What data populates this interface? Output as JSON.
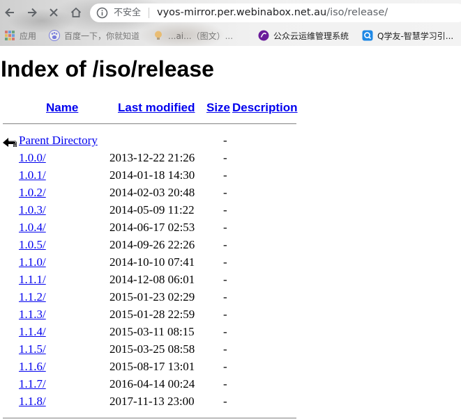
{
  "browser": {
    "security_label": "不安全",
    "url_host": "vyos-mirror.per.webinabox.net.au",
    "url_path": "/iso/release/",
    "bookmarks": [
      {
        "label": "应用",
        "icon": "apps-grid-icon"
      },
      {
        "label": "百度一下，你就知道",
        "icon": "baidu-paw-icon"
      },
      {
        "label": "...ai...（图文）...",
        "icon": "bulb-icon"
      },
      {
        "label": "公众云运维管理系统",
        "icon": "purple-orb-icon"
      },
      {
        "label": "Q学友-智慧学习引...",
        "icon": "q-logo-icon"
      }
    ]
  },
  "page": {
    "title": "Index of /iso/release",
    "headers": {
      "name": "Name",
      "last_modified": "Last modified",
      "size": "Size",
      "description": "Description"
    },
    "parent": {
      "name": "Parent Directory",
      "size": "-"
    },
    "entries": [
      {
        "name": "1.0.0/",
        "modified": "2013-12-22 21:26",
        "size": "-"
      },
      {
        "name": "1.0.1/",
        "modified": "2014-01-18 14:30",
        "size": "-"
      },
      {
        "name": "1.0.2/",
        "modified": "2014-02-03 20:48",
        "size": "-"
      },
      {
        "name": "1.0.3/",
        "modified": "2014-05-09 11:22",
        "size": "-"
      },
      {
        "name": "1.0.4/",
        "modified": "2014-06-17 02:53",
        "size": "-"
      },
      {
        "name": "1.0.5/",
        "modified": "2014-09-26 22:26",
        "size": "-"
      },
      {
        "name": "1.1.0/",
        "modified": "2014-10-10 07:41",
        "size": "-"
      },
      {
        "name": "1.1.1/",
        "modified": "2014-12-08 06:01",
        "size": "-"
      },
      {
        "name": "1.1.2/",
        "modified": "2015-01-23 02:29",
        "size": "-"
      },
      {
        "name": "1.1.3/",
        "modified": "2015-01-28 22:59",
        "size": "-"
      },
      {
        "name": "1.1.4/",
        "modified": "2015-03-11 08:15",
        "size": "-"
      },
      {
        "name": "1.1.5/",
        "modified": "2015-03-25 08:58",
        "size": "-"
      },
      {
        "name": "1.1.6/",
        "modified": "2015-08-17 13:01",
        "size": "-"
      },
      {
        "name": "1.1.7/",
        "modified": "2016-04-14 00:24",
        "size": "-"
      },
      {
        "name": "1.1.8/",
        "modified": "2017-11-13 23:00",
        "size": "-"
      }
    ]
  }
}
